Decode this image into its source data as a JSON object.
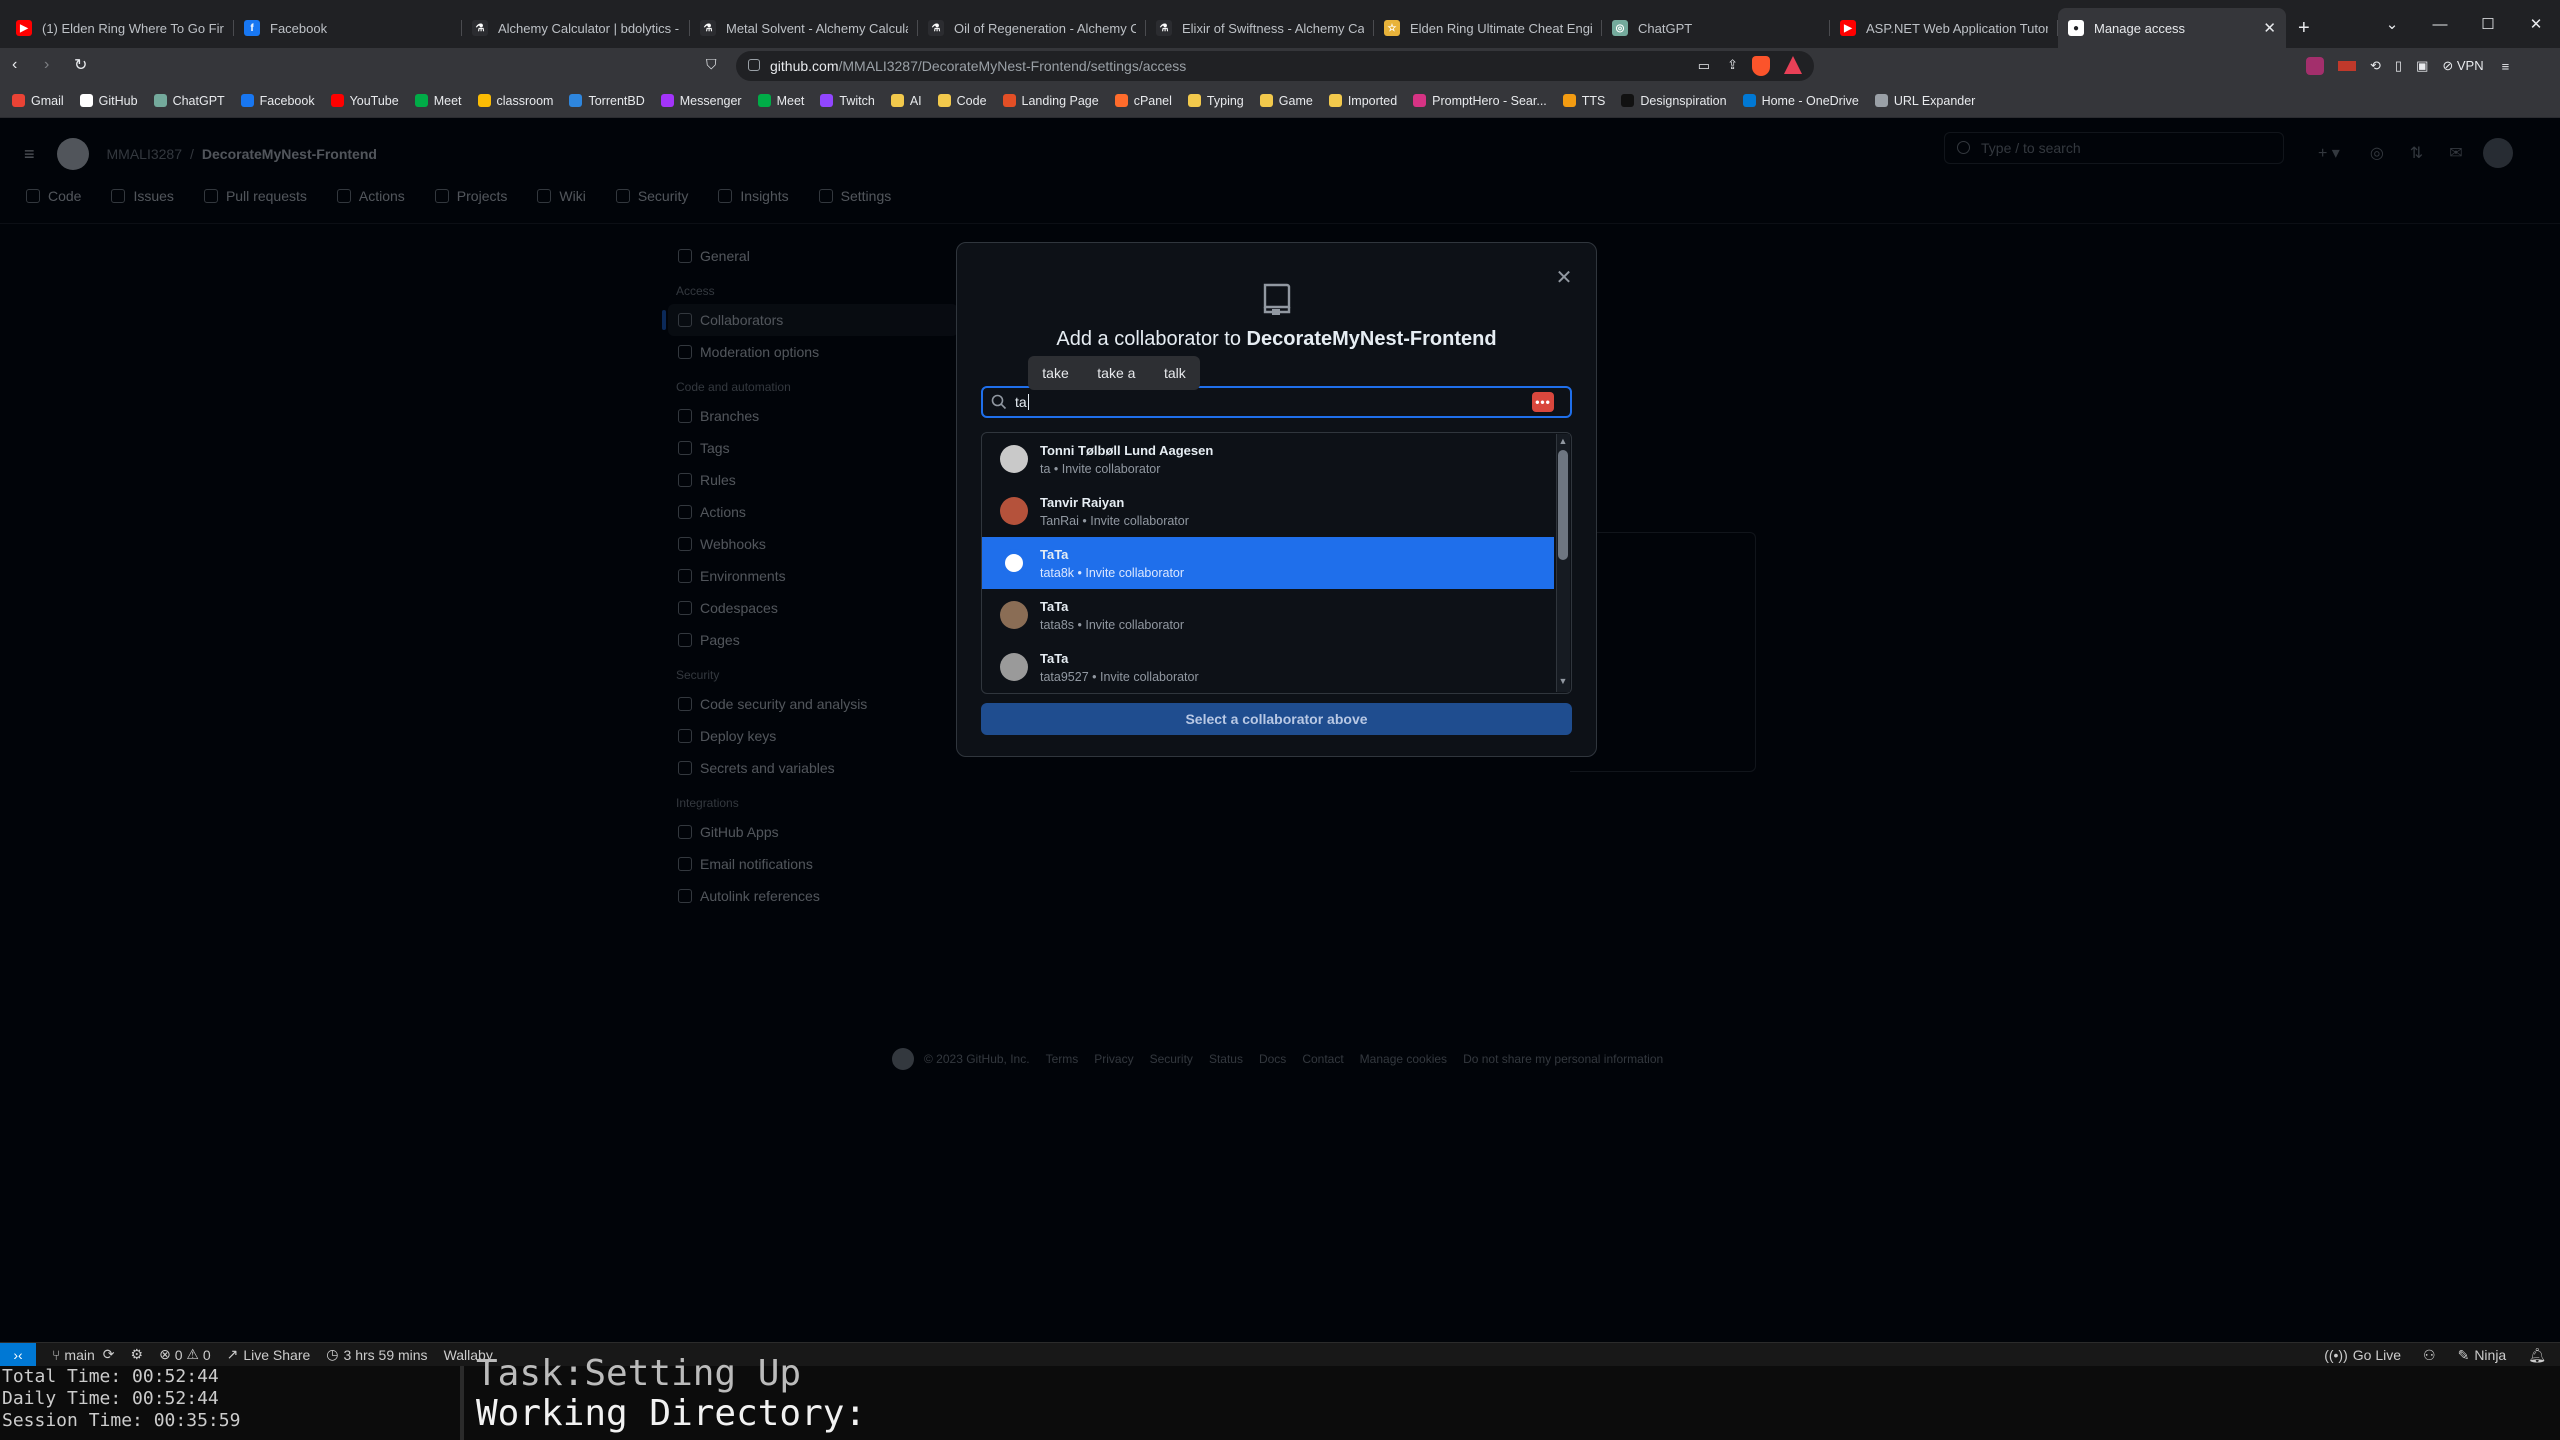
{
  "browser": {
    "tabs": [
      {
        "title": "(1) Elden Ring Where To Go First |",
        "color": "#ff0000",
        "glyph": "▶"
      },
      {
        "title": "Facebook",
        "color": "#1877f2",
        "glyph": "f"
      },
      {
        "title": "Alchemy Calculator | bdolytics - Th",
        "color": "#2b2c30",
        "glyph": "⚗"
      },
      {
        "title": "Metal Solvent - Alchemy Calculato",
        "color": "#2b2c30",
        "glyph": "⚗"
      },
      {
        "title": "Oil of Regeneration - Alchemy Calc",
        "color": "#2b2c30",
        "glyph": "⚗"
      },
      {
        "title": "Elixir of Swiftness - Alchemy Calcul",
        "color": "#2b2c30",
        "glyph": "⚗"
      },
      {
        "title": "Elden Ring Ultimate Cheat Engine",
        "color": "#e8b33a",
        "glyph": "☆"
      },
      {
        "title": "ChatGPT",
        "color": "#74aa9c",
        "glyph": "◎"
      },
      {
        "title": "ASP.NET Web Application Tutorial",
        "color": "#ff0000",
        "glyph": "▶"
      },
      {
        "title": "Manage access",
        "color": "#ffffff",
        "glyph": "●",
        "active": true
      }
    ],
    "url_host": "github.com",
    "url_path": "/MMALI3287/DecorateMyNest-Frontend/settings/access",
    "vpn_label": "VPN",
    "bookmarks": [
      {
        "label": "Gmail",
        "color": "#ea4335"
      },
      {
        "label": "GitHub",
        "color": "#ffffff"
      },
      {
        "label": "ChatGPT",
        "color": "#74aa9c"
      },
      {
        "label": "Facebook",
        "color": "#1877f2"
      },
      {
        "label": "YouTube",
        "color": "#ff0000"
      },
      {
        "label": "Meet",
        "color": "#00ac47"
      },
      {
        "label": "classroom",
        "color": "#fbbc04"
      },
      {
        "label": "TorrentBD",
        "color": "#2e86de"
      },
      {
        "label": "Messenger",
        "color": "#a334fa"
      },
      {
        "label": "Meet",
        "color": "#00ac47"
      },
      {
        "label": "Twitch",
        "color": "#9146ff"
      },
      {
        "label": "AI",
        "color": "#f2c94c"
      },
      {
        "label": "Code",
        "color": "#f2c94c"
      },
      {
        "label": "Landing Page",
        "color": "#e34f26"
      },
      {
        "label": "cPanel",
        "color": "#ff6c2c"
      },
      {
        "label": "Typing",
        "color": "#f2c94c"
      },
      {
        "label": "Game",
        "color": "#f2c94c"
      },
      {
        "label": "Imported",
        "color": "#f2c94c"
      },
      {
        "label": "PromptHero - Sear...",
        "color": "#d63384"
      },
      {
        "label": "TTS",
        "color": "#f39c12"
      },
      {
        "label": "Designspiration",
        "color": "#111111"
      },
      {
        "label": "Home - OneDrive",
        "color": "#0078d4"
      },
      {
        "label": "URL Expander",
        "color": "#9aa0a6"
      }
    ]
  },
  "github": {
    "owner": "MMALI3287",
    "repo": "DecorateMyNest-Frontend",
    "search_placeholder": "Type / to search",
    "repo_nav": [
      "Code",
      "Issues",
      "Pull requests",
      "Actions",
      "Projects",
      "Wiki",
      "Security",
      "Insights",
      "Settings"
    ],
    "sidebar": {
      "general": "General",
      "h_access": "Access",
      "collaborators": "Collaborators",
      "moderation": "Moderation options",
      "h_code": "Code and automation",
      "branches": "Branches",
      "tags": "Tags",
      "rules": "Rules",
      "actions": "Actions",
      "webhooks": "Webhooks",
      "environments": "Environments",
      "codespaces": "Codespaces",
      "pages": "Pages",
      "h_security": "Security",
      "code_security": "Code security and analysis",
      "deploy_keys": "Deploy keys",
      "secrets": "Secrets and variables",
      "h_integrations": "Integrations",
      "github_apps": "GitHub Apps",
      "email_notifications": "Email notifications",
      "autolink": "Autolink references"
    },
    "footer": [
      "© 2023 GitHub, Inc.",
      "Terms",
      "Privacy",
      "Security",
      "Status",
      "Docs",
      "Contact",
      "Manage cookies",
      "Do not share my personal information"
    ]
  },
  "modal": {
    "title_prefix": "Add a collaborator to ",
    "title_repo": "DecorateMyNest-Frontend",
    "search_value": "ta",
    "pw_label": "•••",
    "suggestions": [
      "take",
      "take a",
      "talk"
    ],
    "results": [
      {
        "name": "Tonni Tølbøll Lund Aagesen",
        "sub": "ta • Invite collaborator",
        "avatar": "#c9c9c9"
      },
      {
        "name": "Tanvir Raiyan",
        "sub": "TanRai • Invite collaborator",
        "avatar": "#b5523b"
      },
      {
        "name": "TaTa",
        "sub": "tata8k • Invite collaborator",
        "avatar": "#ffffff",
        "selected": true
      },
      {
        "name": "TaTa",
        "sub": "tata8s • Invite collaborator",
        "avatar": "#8a6d55"
      },
      {
        "name": "TaTa",
        "sub": "tata9527 • Invite collaborator",
        "avatar": "#9a9a9a"
      }
    ],
    "select_button": "Select a collaborator above"
  },
  "vscode": {
    "branch": "main",
    "problems_errors": "0",
    "problems_warnings": "0",
    "live_share": "Live Share",
    "time_tracker": "3 hrs 59 mins",
    "wallaby": "Wallaby",
    "go_live": "Go Live",
    "ninja": "Ninja"
  },
  "terminal": {
    "total_time": "Total Time: 00:52:44",
    "daily_time": "Daily Time: 00:52:44",
    "session_time": "Session Time: 00:35:59",
    "task": "Task:Setting Up",
    "working_dir": "Working Directory:"
  }
}
